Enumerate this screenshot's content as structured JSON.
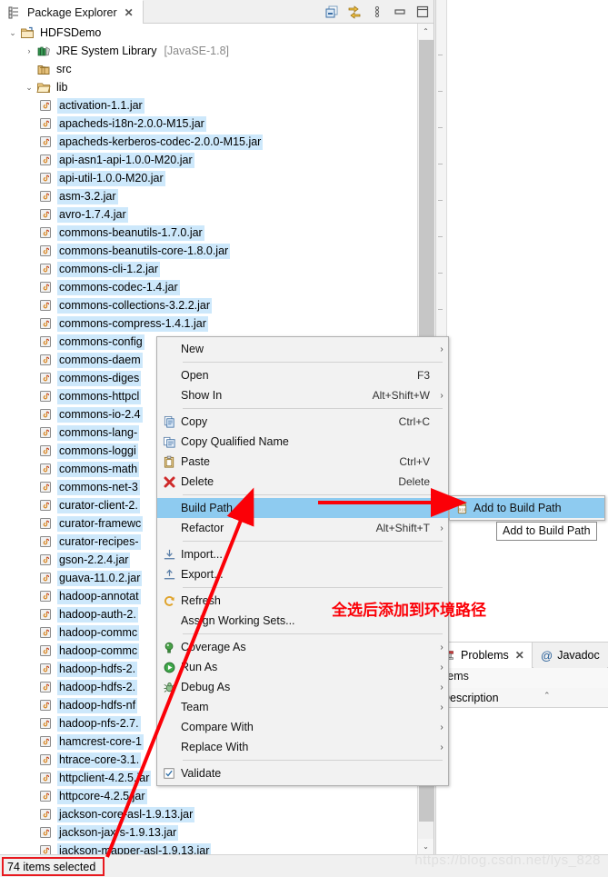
{
  "view": {
    "tab_title": "Package Explorer",
    "close_glyph": "✕",
    "toolbar": [
      {
        "name": "collapse-all-icon",
        "label": "Collapse All"
      },
      {
        "name": "link-with-editor-icon",
        "label": "Link with Editor"
      },
      {
        "name": "view-menu-icon",
        "label": "View Menu"
      },
      {
        "name": "minimize-icon",
        "label": "Minimize"
      },
      {
        "name": "maximize-icon",
        "label": "Maximize"
      }
    ]
  },
  "tree": {
    "project": "HDFSDemo",
    "jre_label": "JRE System Library",
    "jre_suffix": "[JavaSE-1.8]",
    "src": "src",
    "lib": "lib",
    "jars": [
      "activation-1.1.jar",
      "apacheds-i18n-2.0.0-M15.jar",
      "apacheds-kerberos-codec-2.0.0-M15.jar",
      "api-asn1-api-1.0.0-M20.jar",
      "api-util-1.0.0-M20.jar",
      "asm-3.2.jar",
      "avro-1.7.4.jar",
      "commons-beanutils-1.7.0.jar",
      "commons-beanutils-core-1.8.0.jar",
      "commons-cli-1.2.jar",
      "commons-codec-1.4.jar",
      "commons-collections-3.2.2.jar",
      "commons-compress-1.4.1.jar",
      "commons-config",
      "commons-daem",
      "commons-diges",
      "commons-httpcl",
      "commons-io-2.4",
      "commons-lang-",
      "commons-loggi",
      "commons-math",
      "commons-net-3",
      "curator-client-2.",
      "curator-framewc",
      "curator-recipes-",
      "gson-2.2.4.jar",
      "guava-11.0.2.jar",
      "hadoop-annotat",
      "hadoop-auth-2.",
      "hadoop-commc",
      "hadoop-commc",
      "hadoop-hdfs-2.",
      "hadoop-hdfs-2.",
      "hadoop-hdfs-nf",
      "hadoop-nfs-2.7.",
      "hamcrest-core-1",
      "htrace-core-3.1.",
      "httpclient-4.2.5.jar",
      "httpcore-4.2.5.jar",
      "jackson-core-asl-1.9.13.jar",
      "jackson-jaxrs-1.9.13.jar",
      "jackson-mapper-asl-1.9.13.jar"
    ]
  },
  "context_menu": {
    "items": [
      {
        "label": "New",
        "accel": "",
        "arrow": "›",
        "icon": "",
        "sep_after": true
      },
      {
        "label": "Open",
        "accel": "F3",
        "arrow": "",
        "icon": ""
      },
      {
        "label": "Show In",
        "accel": "Alt+Shift+W",
        "arrow": "›",
        "icon": "",
        "sep_after": true
      },
      {
        "label": "Copy",
        "accel": "Ctrl+C",
        "arrow": "",
        "icon": "copy-icon"
      },
      {
        "label": "Copy Qualified Name",
        "accel": "",
        "arrow": "",
        "icon": "copy-qualified-name-icon"
      },
      {
        "label": "Paste",
        "accel": "Ctrl+V",
        "arrow": "",
        "icon": "paste-icon"
      },
      {
        "label": "Delete",
        "accel": "Delete",
        "arrow": "",
        "icon": "delete-icon",
        "sep_after": true
      },
      {
        "label": "Build Path",
        "accel": "",
        "arrow": "›",
        "icon": "",
        "highlighted": true
      },
      {
        "label": "Refactor",
        "accel": "Alt+Shift+T",
        "arrow": "›",
        "icon": "",
        "sep_after": true
      },
      {
        "label": "Import...",
        "accel": "",
        "arrow": "",
        "icon": "import-icon"
      },
      {
        "label": "Export...",
        "accel": "",
        "arrow": "",
        "icon": "export-icon",
        "sep_after": true
      },
      {
        "label": "Refresh",
        "accel": "",
        "arrow": "",
        "icon": "refresh-icon"
      },
      {
        "label": "Assign Working Sets...",
        "accel": "",
        "arrow": "",
        "icon": "",
        "sep_after": true
      },
      {
        "label": "Coverage As",
        "accel": "",
        "arrow": "›",
        "icon": "coverage-icon"
      },
      {
        "label": "Run As",
        "accel": "",
        "arrow": "›",
        "icon": "run-icon"
      },
      {
        "label": "Debug As",
        "accel": "",
        "arrow": "›",
        "icon": "debug-icon"
      },
      {
        "label": "Team",
        "accel": "",
        "arrow": "›",
        "icon": ""
      },
      {
        "label": "Compare With",
        "accel": "",
        "arrow": "›",
        "icon": ""
      },
      {
        "label": "Replace With",
        "accel": "",
        "arrow": "›",
        "icon": "",
        "sep_after": true
      },
      {
        "label": "Validate",
        "accel": "",
        "arrow": "",
        "icon": "checkbox-checked-icon"
      }
    ]
  },
  "submenu": {
    "item_label": "Add to Build Path",
    "icon": "jar-icon"
  },
  "tooltip": {
    "text": "Add to Build Path"
  },
  "annotation": {
    "text": "全选后添加到环境路径",
    "color": "#fb0007"
  },
  "problems_panel": {
    "tab_problems": "Problems",
    "tab_problems_close": "✕",
    "tab_javadoc": "Javadoc",
    "javadoc_icon": "@",
    "count_text": "items",
    "column_description": "Description",
    "sort_arrow": "⌃"
  },
  "statusbar": {
    "selection_text": "74 items selected",
    "box_color": "#e8191f"
  },
  "watermark": {
    "text": "https://blog.csdn.net/lys_828"
  }
}
